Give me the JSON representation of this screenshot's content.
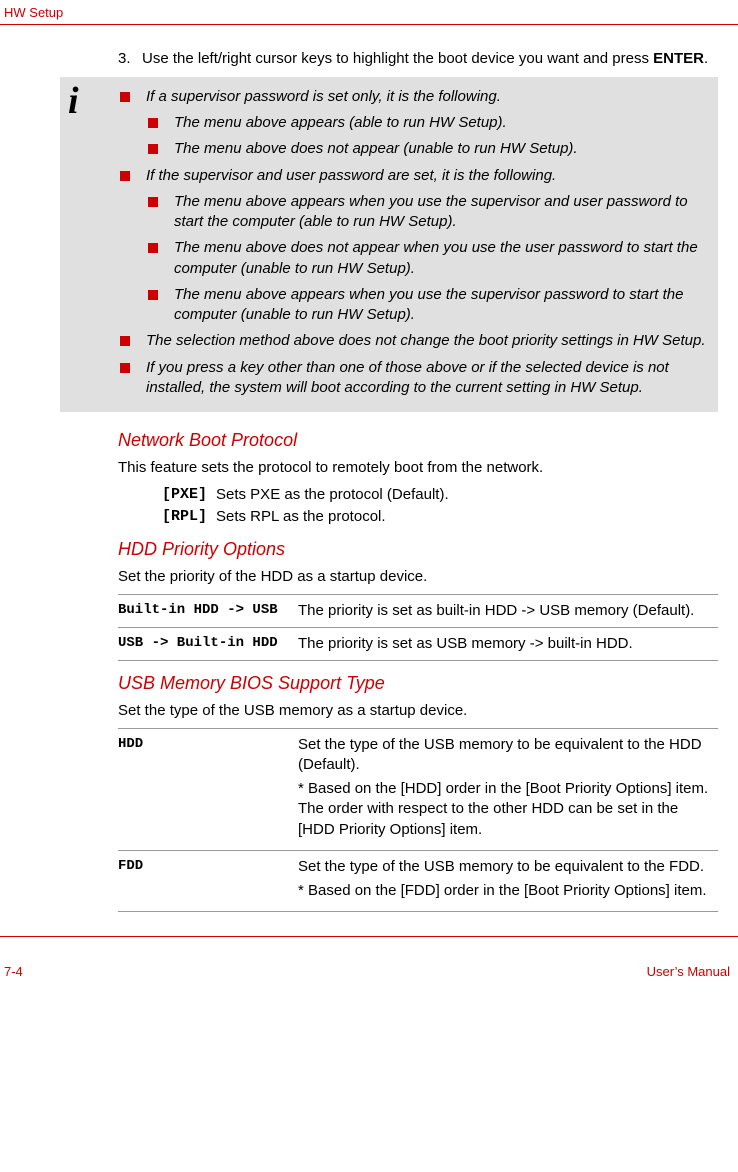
{
  "header": "HW Setup",
  "step": {
    "number": "3.",
    "text_before": "Use the left/right cursor keys to highlight the boot device you want and press ",
    "key": "ENTER",
    "text_after": "."
  },
  "note": {
    "items": [
      {
        "text": "If a supervisor password is set only, it is the following.",
        "indent": false
      },
      {
        "text": "The menu above appears (able to run HW Setup).",
        "indent": true
      },
      {
        "text": "The menu above does not appear (unable to run HW Setup).",
        "indent": true
      },
      {
        "text": "If the supervisor and user password are set, it is the following.",
        "indent": false
      },
      {
        "text": "The menu above appears when you use the supervisor and user password to start the computer (able to run HW Setup).",
        "indent": true
      },
      {
        "text": "The menu above does not appear when you use the user password to start the computer (unable to run HW Setup).",
        "indent": true
      },
      {
        "text": "The menu above appears when you use the supervisor password to start the computer (unable to run HW Setup).",
        "indent": true
      },
      {
        "text": "The selection method above does not change the boot priority settings in HW Setup.",
        "indent": false
      },
      {
        "text": "If you press a key other than one of those above or if the selected device is not installed, the system will boot according to the current setting in HW Setup.",
        "indent": false
      }
    ]
  },
  "sections": {
    "net": {
      "title": "Network Boot Protocol",
      "intro": "This feature sets the protocol to remotely boot from the network.",
      "rows": [
        {
          "label": "[PXE]",
          "desc": "Sets PXE as the protocol (Default)."
        },
        {
          "label": "[RPL]",
          "desc": "Sets RPL as the protocol."
        }
      ]
    },
    "hdd": {
      "title": "HDD Priority Options",
      "intro": "Set the priority of the HDD as a startup device.",
      "rows": [
        {
          "label": "Built-in HDD -> USB",
          "desc": "The priority is set as built-in HDD -> USB memory (Default)."
        },
        {
          "label": "USB -> Built-in HDD",
          "desc": "The priority is set as USB memory -> built-in HDD."
        }
      ]
    },
    "usb": {
      "title": "USB Memory BIOS Support Type",
      "intro": "Set the type of the USB memory as a startup device.",
      "rows": [
        {
          "label": "HDD",
          "desc1": "Set the type of the USB memory to be equivalent to the HDD (Default).",
          "desc2": "* Based on the [HDD] order in the [Boot Priority Options] item. The order with respect to the other HDD can be set in the [HDD Priority Options] item."
        },
        {
          "label": "FDD",
          "desc1": "Set the type of the USB memory to be equivalent to the FDD.",
          "desc2": "* Based on the [FDD] order in the [Boot Priority Options] item."
        }
      ]
    }
  },
  "footer": {
    "left": "7-4",
    "right": "User’s Manual"
  }
}
